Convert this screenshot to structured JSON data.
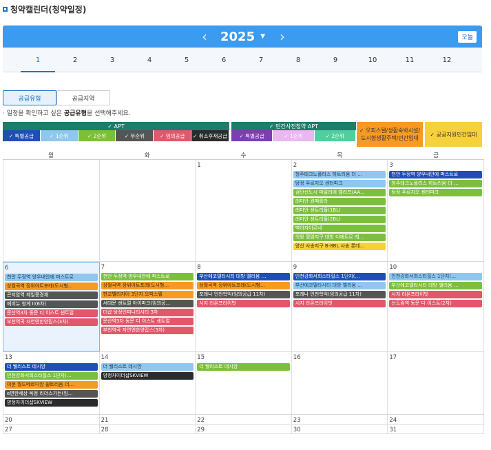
{
  "page_title": "청약캘린더(청약일정)",
  "header": {
    "year": "2025",
    "today_label": "오늘"
  },
  "months": [
    "1",
    "2",
    "3",
    "4",
    "5",
    "6",
    "7",
    "8",
    "9",
    "10",
    "11",
    "12"
  ],
  "tabs": [
    "공급유형",
    "공급지역"
  ],
  "guide": {
    "prefix": "· 일정을 확인하고 싶은 ",
    "bold": "공급유형",
    "suffix": "을 선택해주세요."
  },
  "filters": {
    "apt": {
      "title": "✓ APT",
      "buttons": [
        "✓ 특별공급",
        "✓ 1순위",
        "✓ 2순위",
        "✓ 무순위",
        "✓ 임의공급",
        "✓ 취소후재공급"
      ]
    },
    "private": {
      "title": "✓ 민간사전청약 APT",
      "buttons": [
        "✓ 특별공급",
        "✓ 1순위",
        "✓ 2순위"
      ]
    },
    "officetel": "✓ 오피스텔/생활숙박시설/\n도시형생활주택/민간임대",
    "public_rental": "✓ 공공지원민간임대"
  },
  "weekdays": [
    "월",
    "화",
    "수",
    "목",
    "금"
  ],
  "colors": {
    "special": "#1f4fb3",
    "first": "#8fc7ee",
    "second": "#7cbf3d",
    "none": "#555555",
    "random": "#e0586a",
    "cancel": "#2b2b2b",
    "pspecial": "#7a3fb0",
    "pfirst": "#e9b8f0",
    "psecond": "#4fcf9e",
    "officetel": "#f59a23",
    "rental": "#f7d13a",
    "apt_head": "#1e7d6a"
  },
  "weeks": [
    [
      {
        "num": "",
        "events": []
      },
      {
        "num": "",
        "events": []
      },
      {
        "num": "1",
        "events": []
      },
      {
        "num": "2",
        "events": [
          {
            "t": "청주테크노폴리스 하트리움 더 …",
            "c": "first"
          },
          {
            "t": "탕정 푸르지오 센터파크",
            "c": "first"
          },
          {
            "t": "검단신도시 파밀리에 엘리프(AA…",
            "c": "second"
          },
          {
            "t": "래미안 원페를라",
            "c": "second"
          },
          {
            "t": "래미안 센트리폴(1BL)",
            "c": "second"
          },
          {
            "t": "래미안 센트리폴(2BL)",
            "c": "second"
          },
          {
            "t": "벽어자이르네",
            "c": "second"
          },
          {
            "t": "의왕 월암지구 대방 디에트르 레…",
            "c": "second"
          },
          {
            "t": "양산 사송지구 B-8BL 사송 롯데…",
            "c": "rental"
          }
        ]
      },
      {
        "num": "3",
        "events": [
          {
            "t": "천안 두정역 양우내안에 퍼스트로",
            "c": "special"
          },
          {
            "t": "청주테크노폴리스 하트리움 더 …",
            "c": "second"
          },
          {
            "t": "탕정 푸르지오 센터파크",
            "c": "second"
          }
        ]
      }
    ],
    [
      {
        "num": "6",
        "selected": true,
        "events": [
          {
            "t": "천안 두정역 양우내안에 퍼스트로",
            "c": "first"
          },
          {
            "t": "상월곡역 장위아트포레(도시형…",
            "c": "officetel"
          },
          {
            "t": "곤지암역 제일풍경채",
            "c": "none"
          },
          {
            "t": "에비뉴 청계 II(6차)",
            "c": "none"
          },
          {
            "t": "문산역3차 동문 디 이스트 센트럴",
            "c": "random"
          },
          {
            "t": "부천역곡 자연앤한양립스(3차)",
            "c": "random"
          }
        ]
      },
      {
        "num": "7",
        "events": [
          {
            "t": "천안 두정역 양우내안에 퍼스트로",
            "c": "second"
          },
          {
            "t": "상월곡역 장위아트포레(도시형…",
            "c": "officetel"
          },
          {
            "t": "판교밸리자이 3단지 오피스텔",
            "c": "officetel"
          },
          {
            "t": "서대문 센트럴 아이파크(임의공…",
            "c": "none"
          },
          {
            "t": "더샵 탕정인피니티시티 3차",
            "c": "random"
          },
          {
            "t": "문산역3차 동문 디 이스트 센트럴",
            "c": "random"
          },
          {
            "t": "부천역곡 자연앤한양립스(3차)",
            "c": "random"
          }
        ]
      },
      {
        "num": "8",
        "events": [
          {
            "t": "부산에코델타시티 대방 엘리움 …",
            "c": "special"
          },
          {
            "t": "상월곡역 장위아트포레(도시형…",
            "c": "officetel"
          },
          {
            "t": "포레나 인천학익(임의공급 11차)",
            "c": "none"
          },
          {
            "t": "시지 라온프라이빗",
            "c": "random"
          }
        ]
      },
      {
        "num": "9",
        "events": [
          {
            "t": "인천강화서희스타힐스 1단지(…",
            "c": "special"
          },
          {
            "t": "부산에코델타시티 대방 엘리움 …",
            "c": "first"
          },
          {
            "t": "포레나 인천학익(임의공급 11차)",
            "c": "none"
          },
          {
            "t": "시지 라온프라이빗",
            "c": "random"
          }
        ]
      },
      {
        "num": "10",
        "events": [
          {
            "t": "인천강화서희스타힐스 1단지(…",
            "c": "first"
          },
          {
            "t": "부산에코델타시티 대방 엘리움 …",
            "c": "second"
          },
          {
            "t": "시지 라온프라이빗",
            "c": "random"
          },
          {
            "t": "신도림역 동문 디 이스트(2차)",
            "c": "random"
          }
        ]
      }
    ],
    [
      {
        "num": "13",
        "events": [
          {
            "t": "더 웰리스트 데시앙",
            "c": "special"
          },
          {
            "t": "인천강화서희스타힐스 1단지(…",
            "c": "second"
          },
          {
            "t": "이문 월드메르디앙 윌트리움 더…",
            "c": "officetel"
          },
          {
            "t": "e편한세상 옥정 리더스가든(임…",
            "c": "none"
          },
          {
            "t": "양정자이더샵SKVIEW",
            "c": "cancel"
          }
        ]
      },
      {
        "num": "14",
        "events": [
          {
            "t": "더 웰리스트 데시앙",
            "c": "first"
          },
          {
            "t": "양정자이더샵SKVIEW",
            "c": "cancel"
          }
        ]
      },
      {
        "num": "15",
        "events": [
          {
            "t": "더 웰리스트 데시앙",
            "c": "second"
          }
        ]
      },
      {
        "num": "16",
        "events": []
      },
      {
        "num": "17",
        "events": []
      }
    ],
    [
      {
        "num": "20",
        "events": []
      },
      {
        "num": "21",
        "events": []
      },
      {
        "num": "22",
        "events": []
      },
      {
        "num": "23",
        "events": []
      },
      {
        "num": "24",
        "events": []
      }
    ],
    [
      {
        "num": "27",
        "events": []
      },
      {
        "num": "28",
        "events": []
      },
      {
        "num": "29",
        "events": []
      },
      {
        "num": "30",
        "events": []
      },
      {
        "num": "31",
        "events": []
      }
    ]
  ]
}
